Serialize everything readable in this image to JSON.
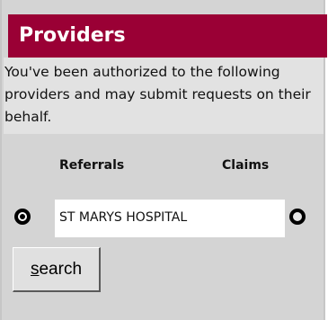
{
  "header": {
    "title": "Providers"
  },
  "description": "You've been authorized to the following providers and may submit requests on their behalf.",
  "columns": {
    "referrals": "Referrals",
    "claims": "Claims"
  },
  "providers": [
    {
      "name": "ST MARYS HOSPITAL",
      "referrals_selected": true,
      "claims_selected": false
    }
  ],
  "search_button": {
    "accesskey": "s",
    "label_rest": "earch"
  }
}
